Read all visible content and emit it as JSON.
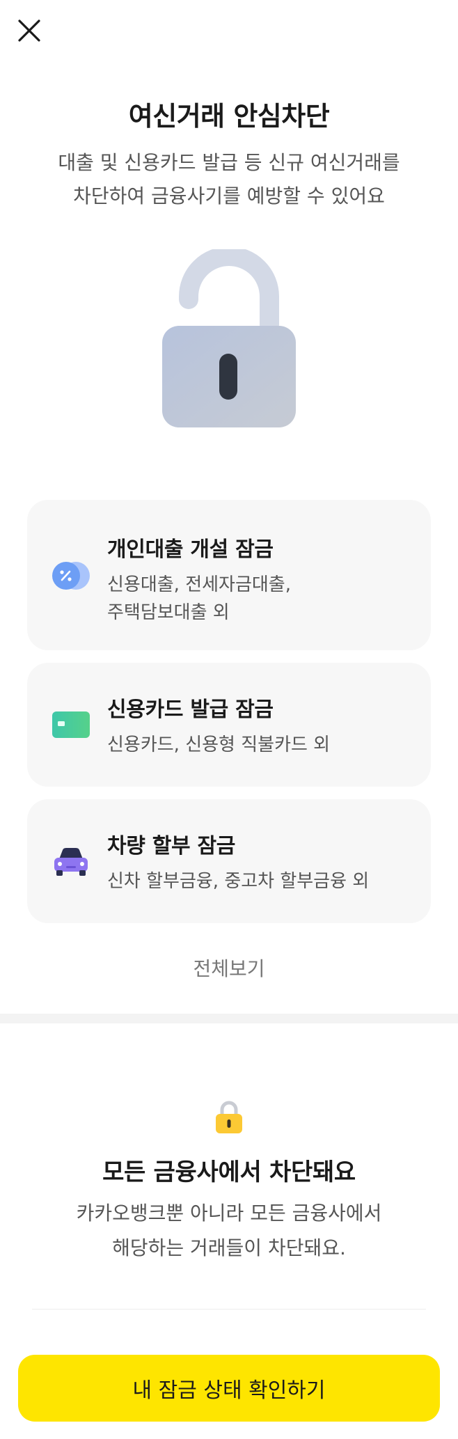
{
  "header": {
    "close_icon": "close-icon"
  },
  "hero": {
    "title": "여신거래 안심차단",
    "subtitle": "대출 및 신용카드 발급 등 신규 여신거래를\n차단하여 금융사기를 예방할 수 있어요",
    "illustration": "unlocked-padlock-icon"
  },
  "lock_items": [
    {
      "icon": "loan-percent-icon",
      "title": "개인대출 개설 잠금",
      "description": "신용대출, 전세자금대출,\n주택담보대출 외"
    },
    {
      "icon": "credit-card-icon",
      "title": "신용카드 발급 잠금",
      "description": "신용카드, 신용형 직불카드 외"
    },
    {
      "icon": "car-icon",
      "title": "차량 할부 잠금",
      "description": "신차 할부금융, 중고차 할부금융 외"
    }
  ],
  "view_all_label": "전체보기",
  "info_section": {
    "icon": "padlock-icon",
    "title": "모든 금융사에서 차단돼요",
    "subtitle": "카카오뱅크뿐 아니라 모든 금융사에서\n해당하는 거래들이 차단돼요."
  },
  "cta_label": "내 잠금 상태 확인하기",
  "colors": {
    "accent": "#fee500",
    "card_bg": "#f7f7f7",
    "text_primary": "#1a1a1a",
    "text_secondary": "#555555"
  }
}
